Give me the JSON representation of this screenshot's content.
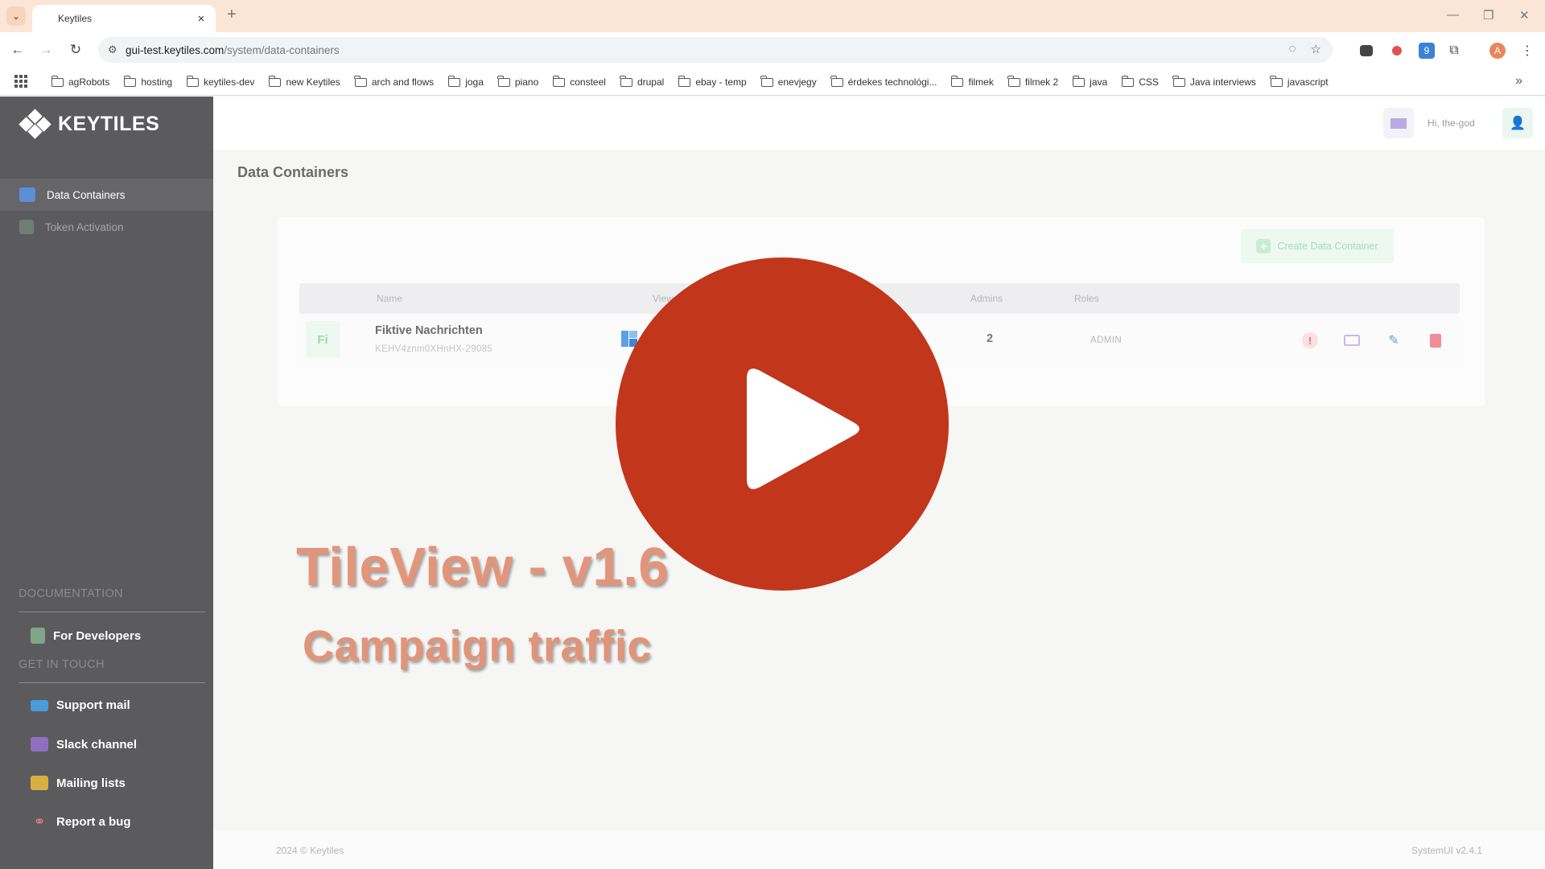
{
  "browser": {
    "tab_title": "Keytiles",
    "tab_close": "×",
    "new_tab": "+",
    "url_host": "gui-test.keytiles.com",
    "url_path": "/system/data-containers",
    "bookmarks": [
      "agRobots",
      "hosting",
      "keytiles-dev",
      "new Keytiles",
      "arch and flows",
      "joga",
      "piano",
      "consteel",
      "drupal",
      "ebay - temp",
      "enevjegy",
      "érdekes technológi...",
      "filmek",
      "filmek 2",
      "java",
      "CSS",
      "Java interviews",
      "javascript"
    ],
    "more_bookmarks": "»",
    "profile_initial": "A",
    "extension_badge": "9"
  },
  "sidebar": {
    "logo_text": "KEYTILES",
    "nav": [
      {
        "label": "Data Containers",
        "active": true
      },
      {
        "label": "Token Activation",
        "active": false
      }
    ],
    "documentation_title": "DOCUMENTATION",
    "documentation_links": [
      {
        "label": "For Developers",
        "icon": "document-icon"
      }
    ],
    "contact_title": "GET IN TOUCH",
    "contact_links": [
      {
        "label": "Support mail",
        "icon": "mail-icon"
      },
      {
        "label": "Slack channel",
        "icon": "chat-icon"
      },
      {
        "label": "Mailing lists",
        "icon": "mailbox-icon"
      },
      {
        "label": "Report a bug",
        "icon": "link-icon"
      }
    ]
  },
  "header": {
    "greeting": "Hi, the-god"
  },
  "page": {
    "title": "Data Containers",
    "create_button": "Create Data Container",
    "columns": [
      "Name",
      "View",
      "Admins",
      "Roles"
    ],
    "rows": [
      {
        "initials": "Fi",
        "name": "Fiktive Nachrichten",
        "id": "KEHV4znm0XHnHX-29085",
        "admins": "2",
        "roles": "ADMIN"
      }
    ]
  },
  "overlay": {
    "title": "TileView - v1.6",
    "subtitle": "Campaign traffic"
  },
  "footer": {
    "copyright": "2024 ©  Keytiles",
    "version": "SystemUI v2.4.1"
  },
  "colors": {
    "sidebar": "#5b5b5e",
    "play_button": "#c2361c",
    "overlay_text": "#e3957a",
    "accent_green": "#a5dcb6"
  }
}
